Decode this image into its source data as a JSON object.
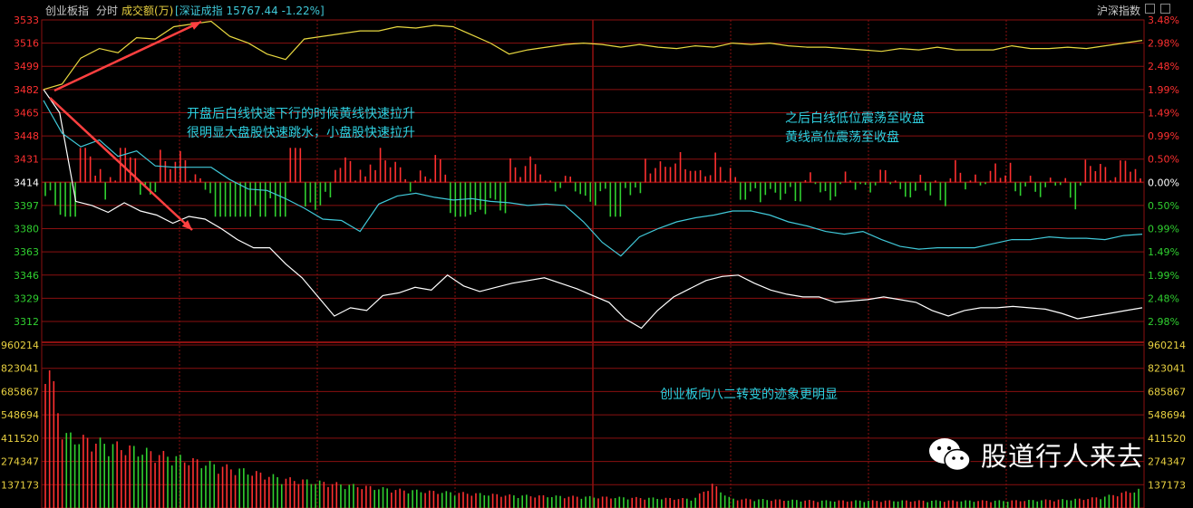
{
  "header": {
    "title": "创业板指",
    "mode": "分时",
    "volume_label": "成交额(万)",
    "szci_label": "[深证成指 15767.44 -1.22%]",
    "right_label": "沪深指数"
  },
  "annotations": {
    "left_line1": "开盘后白线快速下行的时候黄线快速拉升",
    "left_line2": "很明显大盘股快速跳水，小盘股快速拉升",
    "right_line1": "之后白线低位震荡至收盘",
    "right_line2": "黄线高位震荡至收盘",
    "volume_note": "创业板向八二转变的迹象更明显"
  },
  "watermark": {
    "text": "股道行人来去",
    "icon": "wechat-icon"
  },
  "colors": {
    "background": "#000000",
    "grid": "#8a1010",
    "white_line": "#ffffff",
    "yellow_line": "#e8d840",
    "cyan_line": "#40c8d8",
    "up": "#ff3030",
    "down": "#30d030",
    "arrow": "#ff4040"
  },
  "chart_data": {
    "type": "line",
    "price_axis": {
      "ticks": [
        3533,
        3516,
        3499,
        3482,
        3465,
        3448,
        3431,
        3414,
        3397,
        3380,
        3363,
        3346,
        3329,
        3312
      ],
      "range": [
        3312,
        3533
      ],
      "base": 3414
    },
    "pct_axis": {
      "ticks": [
        "3.48%",
        "2.98%",
        "2.48%",
        "1.99%",
        "1.49%",
        "0.99%",
        "0.50%",
        "0.00%",
        "0.50%",
        "0.99%",
        "1.49%",
        "1.99%",
        "2.48%",
        "2.98%"
      ]
    },
    "volume_axis": {
      "ticks": [
        960214,
        823041,
        685867,
        548694,
        411520,
        274347,
        137173
      ],
      "range": [
        0,
        960214
      ]
    },
    "series": [
      {
        "color": "white",
        "values": [
          3482,
          3465,
          3400,
          3397,
          3392,
          3399,
          3393,
          3390,
          3384,
          3389,
          3387,
          3380,
          3372,
          3366,
          3366,
          3354,
          3344,
          3330,
          3316,
          3322,
          3320,
          3331,
          3333,
          3337,
          3335,
          3346,
          3338,
          3334,
          3337,
          3340,
          3342,
          3344,
          3340,
          3336,
          3331,
          3326,
          3314,
          3307,
          3320,
          3330,
          3336,
          3342,
          3345,
          3346,
          3340,
          3335,
          3332,
          3330,
          3330,
          3326,
          3327,
          3328,
          3330,
          3328,
          3326,
          3320,
          3316,
          3320,
          3322,
          3322,
          3323,
          3322,
          3321,
          3318,
          3314,
          3316,
          3318,
          3320,
          3322
        ]
      },
      {
        "color": "yellow",
        "values": [
          3482,
          3486,
          3505,
          3512,
          3509,
          3520,
          3519,
          3528,
          3530,
          3532,
          3521,
          3516,
          3508,
          3504,
          3519,
          3521,
          3523,
          3525,
          3525,
          3528,
          3527,
          3529,
          3528,
          3522,
          3516,
          3508,
          3511,
          3513,
          3515,
          3516,
          3515,
          3513,
          3515,
          3513,
          3512,
          3514,
          3513,
          3516,
          3515,
          3516,
          3514,
          3513,
          3513,
          3512,
          3511,
          3510,
          3512,
          3511,
          3513,
          3511,
          3511,
          3511,
          3514,
          3512,
          3512,
          3513,
          3512,
          3514,
          3516,
          3518
        ]
      },
      {
        "color": "cyan",
        "values": [
          3474,
          3450,
          3440,
          3445,
          3433,
          3437,
          3426,
          3425,
          3425,
          3425,
          3416,
          3409,
          3408,
          3402,
          3395,
          3387,
          3386,
          3378,
          3398,
          3404,
          3406,
          3403,
          3401,
          3402,
          3400,
          3399,
          3397,
          3398,
          3397,
          3385,
          3370,
          3360,
          3374,
          3380,
          3385,
          3388,
          3390,
          3393,
          3393,
          3390,
          3385,
          3382,
          3378,
          3376,
          3378,
          3372,
          3367,
          3365,
          3366,
          3366,
          3366,
          3369,
          3372,
          3372,
          3374,
          3373,
          3373,
          3372,
          3375,
          3376
        ]
      }
    ],
    "volume": [
      860000,
      400000,
      380000,
      360000,
      340000,
      320000,
      300000,
      280000,
      260000,
      240000,
      220000,
      200000,
      180000,
      160000,
      150000,
      140000,
      130000,
      120000,
      110000,
      100000,
      95000,
      90000,
      85000,
      80000,
      75000,
      70000,
      68000,
      66000,
      64000,
      62000,
      60000,
      58000,
      56000,
      54000,
      52000,
      50000,
      130000,
      50000,
      48000,
      46000,
      44000,
      42000,
      40000,
      40000,
      40000,
      40000,
      40000,
      40000,
      40000,
      40000,
      40000,
      40000,
      40000,
      42000,
      44000,
      46000,
      50000,
      60000,
      80000,
      100000
    ]
  }
}
